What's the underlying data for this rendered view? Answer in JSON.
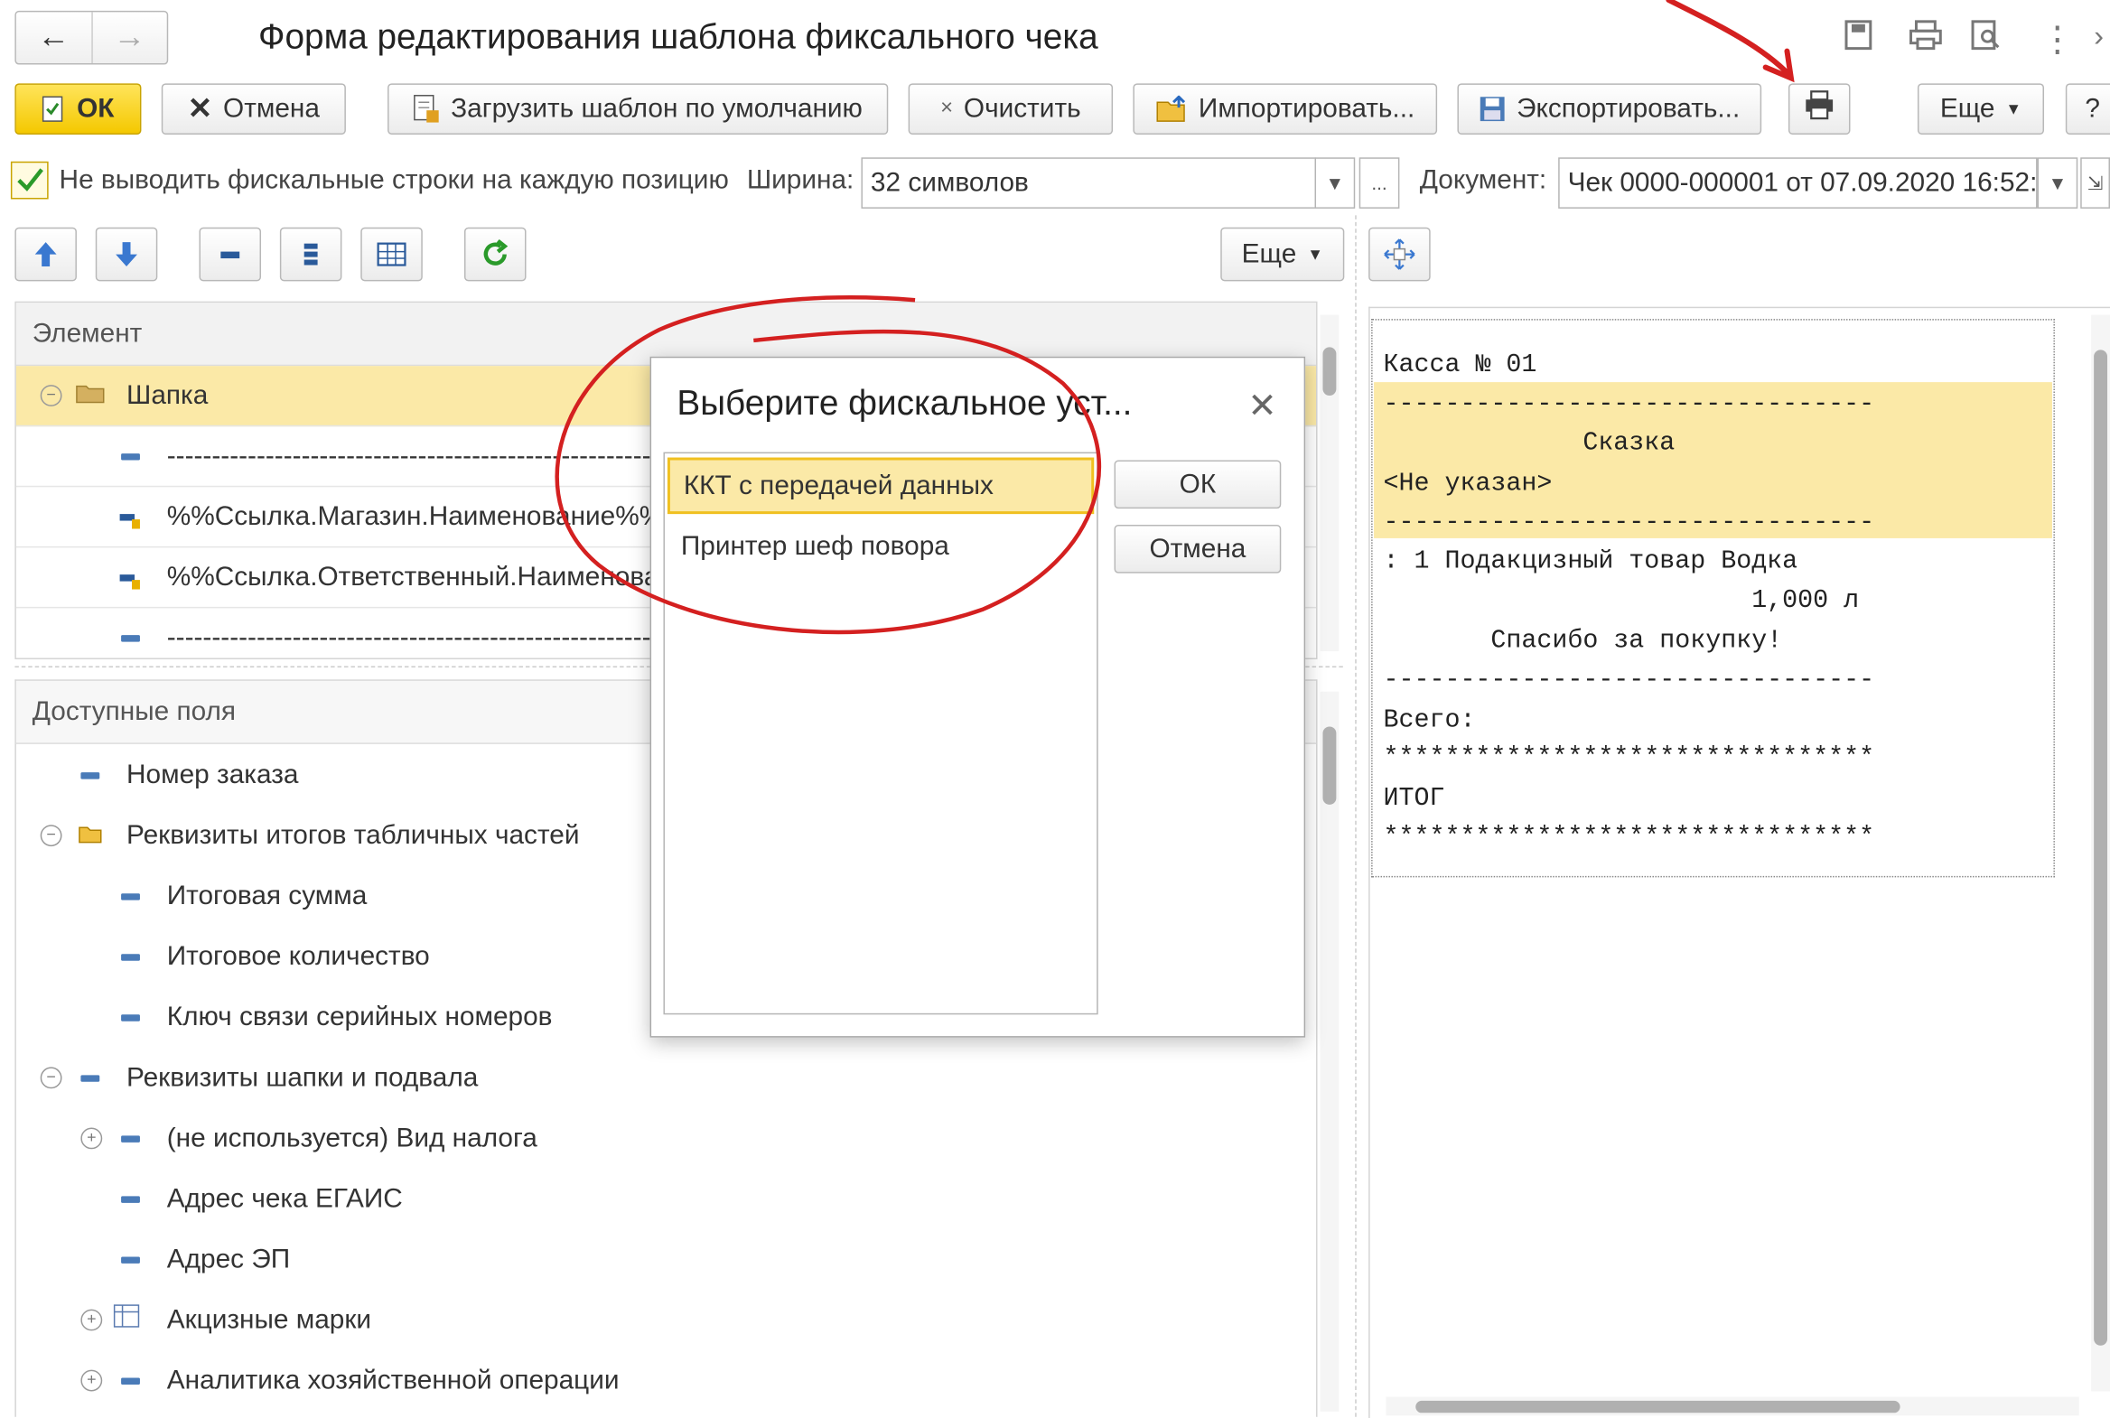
{
  "window": {
    "title": "Форма редактирования шаблона фиксального чека",
    "back_icon": "arrow-left-icon",
    "forward_icon": "arrow-right-icon"
  },
  "toolbar": {
    "ok": "ОК",
    "cancel": "Отмена",
    "load_default": "Загрузить шаблон по умолчанию",
    "clear": "Очистить",
    "import": "Импортировать...",
    "export": "Экспортировать...",
    "more": "Еще",
    "help": "?"
  },
  "options": {
    "checkbox_label": "Не выводить фискальные строки на каждую позицию",
    "checkbox_checked": true,
    "width_label": "Ширина:",
    "width_value": "32 символов",
    "document_label": "Документ:",
    "document_value": "Чек 0000-000001 от 07.09.2020 16:52:",
    "ellipsis": "..."
  },
  "tree_toolbar": {
    "more": "Еще"
  },
  "elements_panel": {
    "header": "Элемент",
    "rows": [
      {
        "text": "Шапка",
        "selected": true
      },
      {
        "text": "-----------------------------------------------------------------------"
      },
      {
        "text": "%%Ссылка.Магазин.Наименование%%"
      },
      {
        "text": "%%Ссылка.Ответственный.Наименова"
      },
      {
        "text": "-----------------------------------------------------------------------"
      }
    ]
  },
  "fields_panel": {
    "header": "Доступные поля",
    "rows": [
      {
        "text": "Номер заказа"
      },
      {
        "text": "Реквизиты итогов табличных частей"
      },
      {
        "text": "Итоговая сумма"
      },
      {
        "text": "Итоговое количество"
      },
      {
        "text": "Ключ связи серийных номеров"
      },
      {
        "text": "Реквизиты шапки и подвала"
      },
      {
        "text": "(не используется) Вид налога"
      },
      {
        "text": "Адрес чека ЕГАИС"
      },
      {
        "text": "Адрес ЭП"
      },
      {
        "text": "Акцизные марки"
      },
      {
        "text": "Аналитика хозяйственной операции"
      }
    ]
  },
  "receipt": {
    "lines": [
      "Касса № 01",
      "--------------------------------",
      "             Сказка",
      "<Не указан>",
      "--------------------------------",
      ": 1 Подакцизный товар Водка",
      "                        1,000 л",
      "       Спасибо за покупку!",
      "--------------------------------",
      "Всего:",
      "********************************",
      "ИТОГ",
      "********************************"
    ]
  },
  "dialog": {
    "title": "Выберите фискальное уст...",
    "items": [
      {
        "text": "ККТ с передачей данных",
        "selected": true
      },
      {
        "text": "Принтер шеф повора"
      }
    ],
    "ok": "ОК",
    "cancel": "Отмена"
  },
  "colors": {
    "accent_yellow": "#f4c800",
    "selection": "#fbe9a7",
    "annotation_red": "#d42020"
  }
}
